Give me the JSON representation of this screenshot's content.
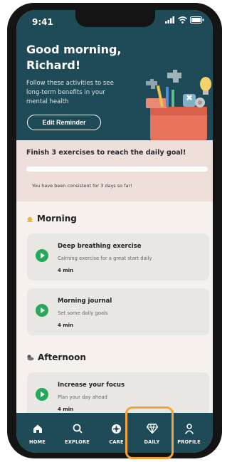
{
  "status_bar": {
    "time": "9:41"
  },
  "header": {
    "greeting": "Good morning, Richard!",
    "subtitle": "Follow these activities to see long-term benefits in your mental health",
    "edit_button": "Edit Reminder"
  },
  "goal": {
    "title": "Finish 3 exercises to reach the daily goal!",
    "progress": 0,
    "note": "You have been consistent for 3 days so far!"
  },
  "sections": [
    {
      "title": "Morning",
      "icon": "sun-icon",
      "items": [
        {
          "title": "Deep breathing exercise",
          "description": "Calming exercise for a great start daily",
          "duration": "4 min"
        },
        {
          "title": "Morning journal",
          "description": "Set some daily goals",
          "duration": "4 min"
        }
      ]
    },
    {
      "title": "Afternoon",
      "icon": "cloud-sun-icon",
      "items": [
        {
          "title": "Increase your focus",
          "description": "Plan your day ahead",
          "duration": "4 min"
        }
      ]
    }
  ],
  "tabs": [
    {
      "label": "HOME",
      "icon": "home-icon"
    },
    {
      "label": "EXPLORE",
      "icon": "search-icon"
    },
    {
      "label": "CARE",
      "icon": "care-icon"
    },
    {
      "label": "DAILY",
      "icon": "diamond-icon"
    },
    {
      "label": "PROFILE",
      "icon": "person-icon"
    }
  ],
  "colors": {
    "header_bg": "#1f4a58",
    "goal_bg": "#eedfdb",
    "accent_green": "#27a85a",
    "highlight": "#f4a43a"
  }
}
